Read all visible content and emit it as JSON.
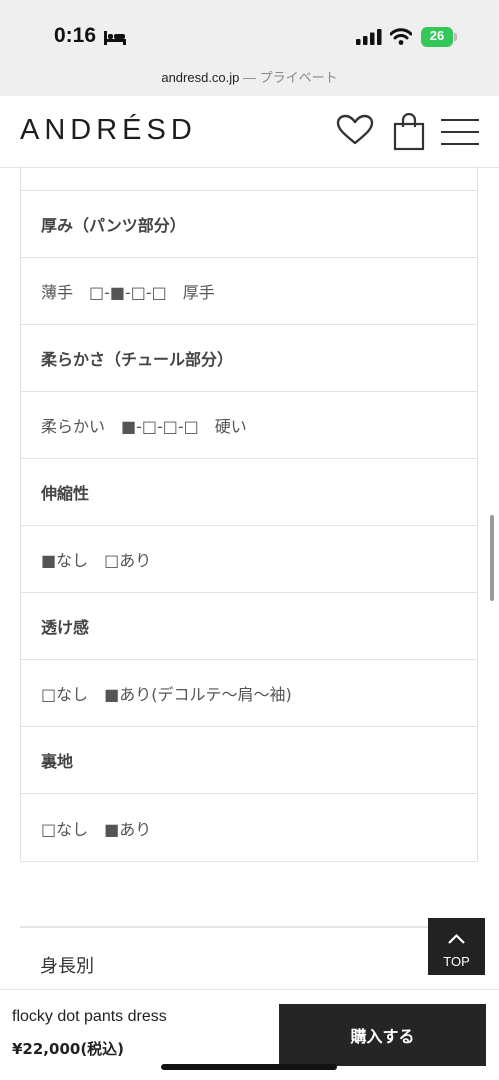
{
  "status_bar": {
    "time": "0:16",
    "battery_level": "26"
  },
  "browser": {
    "domain": "andresd.co.jp",
    "suffix": " — プライベート"
  },
  "header": {
    "logo": "ANDRÉSD",
    "icons": [
      "heart-icon",
      "bag-icon",
      "menu-icon"
    ]
  },
  "spec_rows": [
    {
      "type": "label",
      "text": "厚み（パンツ部分）"
    },
    {
      "type": "value",
      "text": "薄手　□-■-□-□　厚手"
    },
    {
      "type": "label",
      "text": "柔らかさ（チュール部分）"
    },
    {
      "type": "value",
      "text": "柔らかい　■-□-□-□　硬い"
    },
    {
      "type": "label",
      "text": "伸縮性"
    },
    {
      "type": "value",
      "text": "■なし　□あり"
    },
    {
      "type": "label",
      "text": "透け感"
    },
    {
      "type": "value",
      "text": "□なし　■あり(デコルテ〜肩〜袖)"
    },
    {
      "type": "label",
      "text": "裏地"
    },
    {
      "type": "value",
      "text": "□なし　■あり"
    }
  ],
  "size_section": {
    "heading": "身長別"
  },
  "top_button": {
    "label": "TOP"
  },
  "bottom_bar": {
    "product_name": "flocky dot pants dress",
    "price": "¥22,000(税込)",
    "buy_label": "購入する"
  }
}
